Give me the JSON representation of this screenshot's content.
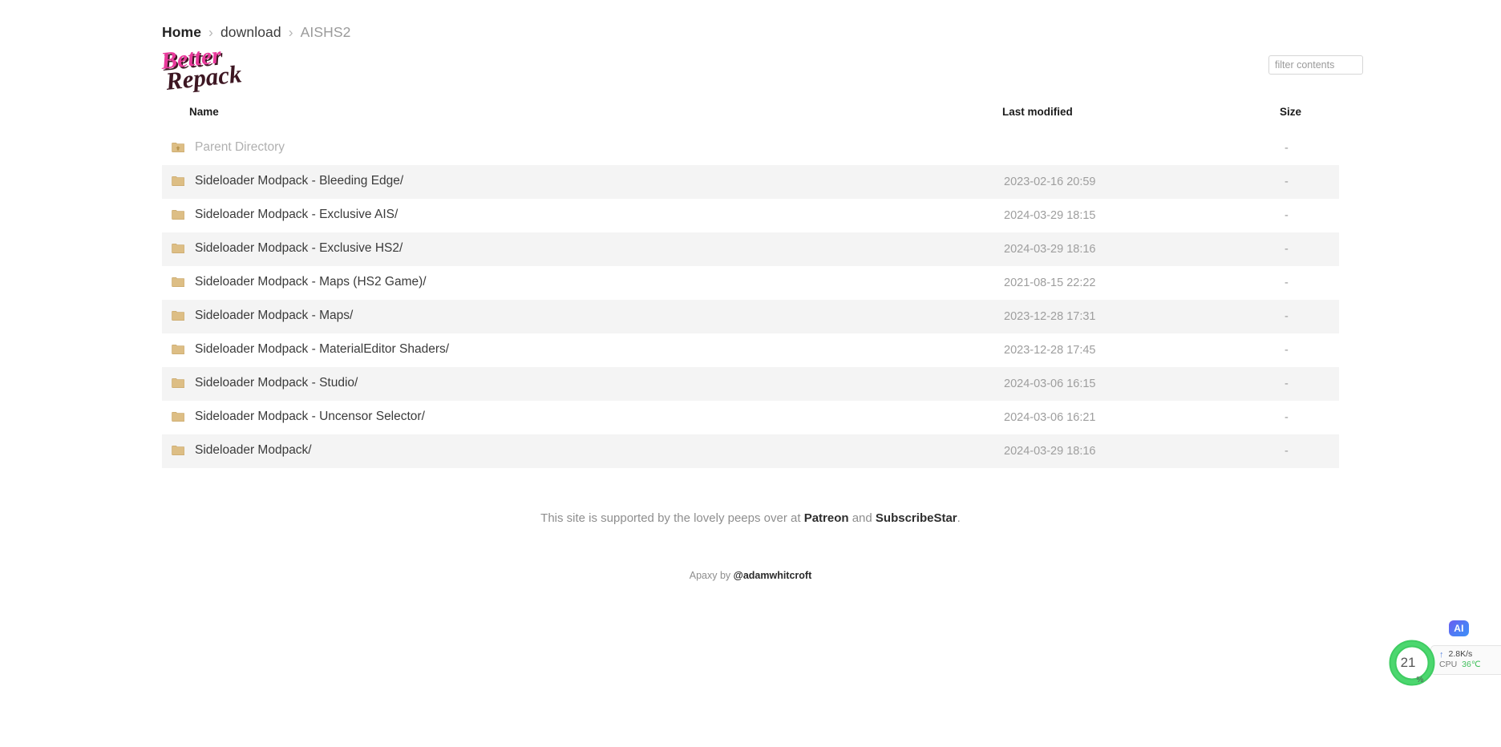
{
  "breadcrumb": {
    "home": "Home",
    "separator": "›",
    "parent": "download",
    "current": "AISHS2"
  },
  "logo": {
    "line1": "Better",
    "line2": "Repack",
    "color_top": "#e8399b",
    "color_bottom": "#3d1622"
  },
  "search": {
    "placeholder": "filter contents",
    "value": ""
  },
  "table": {
    "headers": {
      "name": "Name",
      "last_modified": "Last modified",
      "size": "Size"
    },
    "parent_row": {
      "label": "Parent Directory",
      "last_modified": "",
      "size": "-",
      "icon": "folder-up-icon"
    },
    "rows": [
      {
        "name": "Sideloader Modpack - Bleeding Edge/",
        "last_modified": "2023-02-16 20:59",
        "size": "-",
        "icon": "folder-icon"
      },
      {
        "name": "Sideloader Modpack - Exclusive AIS/",
        "last_modified": "2024-03-29 18:15",
        "size": "-",
        "icon": "folder-icon"
      },
      {
        "name": "Sideloader Modpack - Exclusive HS2/",
        "last_modified": "2024-03-29 18:16",
        "size": "-",
        "icon": "folder-icon"
      },
      {
        "name": "Sideloader Modpack - Maps (HS2 Game)/",
        "last_modified": "2021-08-15 22:22",
        "size": "-",
        "icon": "folder-icon"
      },
      {
        "name": "Sideloader Modpack - Maps/",
        "last_modified": "2023-12-28 17:31",
        "size": "-",
        "icon": "folder-icon"
      },
      {
        "name": "Sideloader Modpack - MaterialEditor Shaders/",
        "last_modified": "2023-12-28 17:45",
        "size": "-",
        "icon": "folder-icon"
      },
      {
        "name": "Sideloader Modpack - Studio/",
        "last_modified": "2024-03-06 16:15",
        "size": "-",
        "icon": "folder-icon"
      },
      {
        "name": "Sideloader Modpack - Uncensor Selector/",
        "last_modified": "2024-03-06 16:21",
        "size": "-",
        "icon": "folder-icon"
      },
      {
        "name": "Sideloader Modpack/",
        "last_modified": "2024-03-29 18:16",
        "size": "-",
        "icon": "folder-icon"
      }
    ]
  },
  "footer": {
    "support_prefix": "This site is supported by the lovely peeps over at ",
    "patreon": "Patreon",
    "support_middle": " and ",
    "subscribestar": "SubscribeStar",
    "support_suffix": ".",
    "credit_prefix": "Apaxy by ",
    "credit_author": "@adamwhitcroft"
  },
  "perf_widget": {
    "ai_badge": "AI",
    "cpu_percent": "21",
    "percent_sign": "%",
    "upload_arrow": "↑",
    "network_speed": "2.8K/s",
    "cpu_label": "CPU",
    "cpu_temp": "36℃",
    "ring_color": "#3fcc62"
  }
}
